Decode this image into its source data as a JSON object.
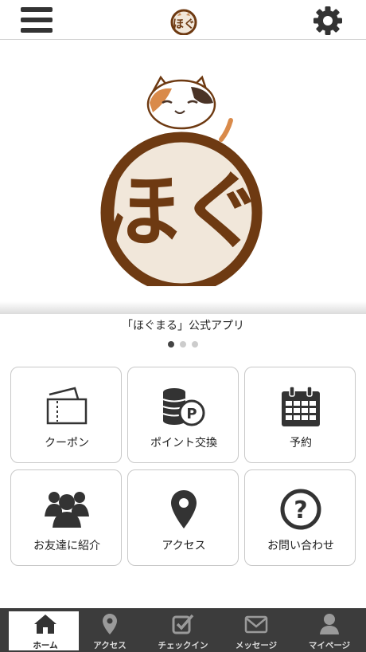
{
  "header": {
    "menu_icon": "hamburger-menu-icon",
    "logo_icon": "hoguru-logo",
    "settings_icon": "gear-icon"
  },
  "banner": {
    "caption": "「ほぐまる」公式アプリ",
    "slide_count": 3,
    "active_slide": 1
  },
  "colors": {
    "brand_brown": "#6e3a12",
    "cream": "#f1e7da",
    "dark": "#333333",
    "tabbar": "#3c3c3c"
  },
  "tiles": [
    {
      "label": "クーポン",
      "icon": "ticket-icon"
    },
    {
      "label": "ポイント交換",
      "icon": "coins-point-icon"
    },
    {
      "label": "予約",
      "icon": "calendar-icon"
    },
    {
      "label": "お友達に紹介",
      "icon": "users-group-icon"
    },
    {
      "label": "アクセス",
      "icon": "map-pin-icon"
    },
    {
      "label": "お問い合わせ",
      "icon": "question-circle-icon"
    }
  ],
  "tabs": [
    {
      "label": "ホーム",
      "icon": "home-icon",
      "active": true
    },
    {
      "label": "アクセス",
      "icon": "map-pin-icon",
      "active": false
    },
    {
      "label": "チェックイン",
      "icon": "checkbox-icon",
      "active": false
    },
    {
      "label": "メッセージ",
      "icon": "envelope-icon",
      "active": false
    },
    {
      "label": "マイページ",
      "icon": "user-icon",
      "active": false
    }
  ]
}
